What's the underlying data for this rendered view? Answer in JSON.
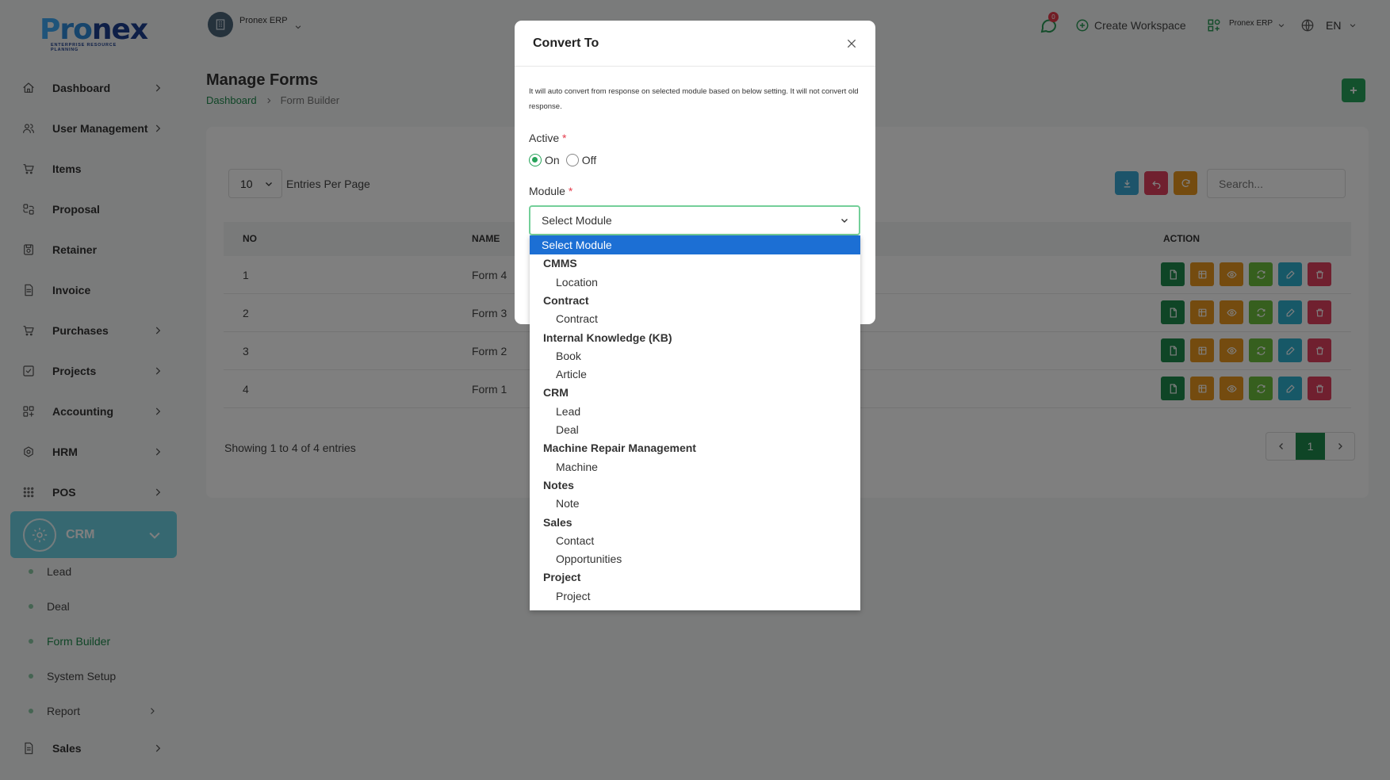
{
  "logo": {
    "part1": "P",
    "part2": "ro",
    "part3": "nex",
    "tagline": "ENTERPRISE RESOURCE PLANNING"
  },
  "header": {
    "workspace_name": "Pronex ERP",
    "notification_count": "0",
    "create_workspace_label": "Create Workspace",
    "app_switch_label": "Pronex ERP",
    "language": "EN"
  },
  "sidebar": {
    "items": [
      {
        "label": "Dashboard",
        "icon": "home-icon",
        "has_arrow": true
      },
      {
        "label": "User Management",
        "icon": "users-icon",
        "has_arrow": true
      },
      {
        "label": "Items",
        "icon": "cart-icon",
        "has_arrow": false
      },
      {
        "label": "Proposal",
        "icon": "proposal-icon",
        "has_arrow": false
      },
      {
        "label": "Retainer",
        "icon": "retainer-icon",
        "has_arrow": false
      },
      {
        "label": "Invoice",
        "icon": "invoice-icon",
        "has_arrow": false
      },
      {
        "label": "Purchases",
        "icon": "cart-icon",
        "has_arrow": true
      },
      {
        "label": "Projects",
        "icon": "check-square-icon",
        "has_arrow": true
      },
      {
        "label": "Accounting",
        "icon": "grid-icon",
        "has_arrow": true
      },
      {
        "label": "HRM",
        "icon": "hrm-icon",
        "has_arrow": true
      },
      {
        "label": "POS",
        "icon": "dots-grid-icon",
        "has_arrow": true
      }
    ],
    "crm": {
      "label": "CRM",
      "sub_items": [
        {
          "label": "Lead",
          "active": false,
          "has_arrow": false
        },
        {
          "label": "Deal",
          "active": false,
          "has_arrow": false
        },
        {
          "label": "Form Builder",
          "active": true,
          "has_arrow": false
        },
        {
          "label": "System Setup",
          "active": false,
          "has_arrow": false
        },
        {
          "label": "Report",
          "active": false,
          "has_arrow": true
        }
      ]
    },
    "sales": {
      "label": "Sales"
    }
  },
  "page": {
    "title": "Manage Forms",
    "breadcrumb": {
      "home": "Dashboard",
      "current": "Form Builder"
    }
  },
  "table": {
    "entries_value": "10",
    "entries_label": "Entries Per Page",
    "search_placeholder": "Search...",
    "columns": {
      "no": "NO",
      "name": "NAME",
      "action": "ACTION"
    },
    "rows": [
      {
        "no": "1",
        "name": "Form 4"
      },
      {
        "no": "2",
        "name": "Form 3"
      },
      {
        "no": "3",
        "name": "Form 2"
      },
      {
        "no": "4",
        "name": "Form 1"
      }
    ],
    "footer": "Showing 1 to 4 of 4 entries",
    "current_page": "1"
  },
  "colors": {
    "accent": "#27a35a",
    "crm_active": "#6dd1e3",
    "download": "#3aa9d4",
    "undo": "#e0405e",
    "refresh": "#e8961e",
    "selected_option": "#1c6fd4"
  },
  "modal": {
    "title": "Convert To",
    "note": "It will auto convert from response on selected module based on below setting. It will not convert old response.",
    "active_label": "Active",
    "required_mark": "*",
    "on_label": "On",
    "off_label": "Off",
    "module_label": "Module",
    "module_value": "Select Module"
  },
  "dropdown": {
    "options": [
      {
        "label": "Select Module",
        "kind": "selected"
      },
      {
        "label": "CMMS",
        "kind": "group"
      },
      {
        "label": "Location",
        "kind": "child"
      },
      {
        "label": "Contract",
        "kind": "group"
      },
      {
        "label": "Contract",
        "kind": "child"
      },
      {
        "label": "Internal Knowledge (KB)",
        "kind": "group"
      },
      {
        "label": "Book",
        "kind": "child"
      },
      {
        "label": "Article",
        "kind": "child"
      },
      {
        "label": "CRM",
        "kind": "group"
      },
      {
        "label": "Lead",
        "kind": "child"
      },
      {
        "label": "Deal",
        "kind": "child"
      },
      {
        "label": "Machine Repair Management",
        "kind": "group"
      },
      {
        "label": "Machine",
        "kind": "child"
      },
      {
        "label": "Notes",
        "kind": "group"
      },
      {
        "label": "Note",
        "kind": "child"
      },
      {
        "label": "Sales",
        "kind": "group"
      },
      {
        "label": "Contact",
        "kind": "child"
      },
      {
        "label": "Opportunities",
        "kind": "child"
      },
      {
        "label": "Project",
        "kind": "group"
      },
      {
        "label": "Project",
        "kind": "child"
      }
    ]
  }
}
